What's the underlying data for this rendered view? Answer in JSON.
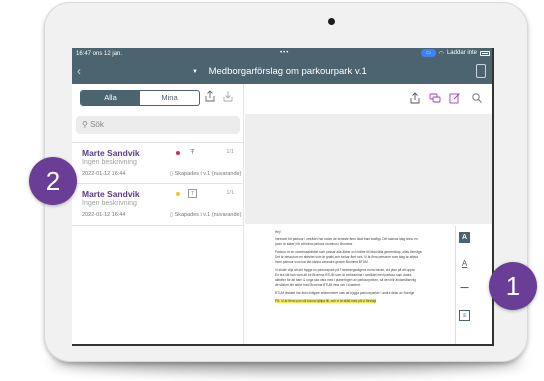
{
  "statusbar": {
    "time": "16:47  ons 12 jan.",
    "dots": "•••",
    "charging": "Laddar inte"
  },
  "navbar": {
    "title": "Medborgarförslag om parkourpark  v.1",
    "back_icon": "chevron-left-icon"
  },
  "tabs": {
    "all": "Alla",
    "mine": "Mina"
  },
  "search": {
    "placeholder": "Sök"
  },
  "items": [
    {
      "name": "Marte Sandvik",
      "desc": "Ingen beskrivning",
      "date": "2022-01-12 16:44",
      "status": "Skapades i v.1 (nuvarande)",
      "count": "1/1",
      "dot_color": "#e0245e"
    },
    {
      "name": "Marte Sandvik",
      "desc": "Ingen beskrivning",
      "date": "2022-01-12 16:44",
      "status": "Skapades i v.1 (nuvarande)",
      "count": "1/1",
      "dot_color": "#f5c518"
    }
  ],
  "document": {
    "greeting": "Hej!",
    "lines": [
      "Intresset för parkour i området har under de senaste åren ökat fram kraftigt. Det saknas idag ännu en",
      "(som är säker) för att träna parkour utomhus i Bromma.",
      "Parkour är en utomhusaktivitet som passar alla åldrar och bättre till lära hålla gemenskap, allas förmåga",
      "Det är dessutom en aktivitet som är gratis och funkar året runt. Vi är flera personer som idag är aktiva",
      "inom parkour som har lärt känna varandra genom Bromma BTUM.",
      "Vi skulle vilja att det byggs en parkourpark på Tranebergsvägens norra backe, vid ytan på att uppta",
      "En bra idé kan vara att be Bromma BTUM som är verksamma i området med parkour sam andra",
      "aktiviter för att barn & unga ska vara med i planeringen av parkourparken, så den blir ändamålsenlig",
      "de såklart blir aktivt med Bromma BTUM hela och i kvarteret.",
      "BTUM tävlatet har även tidigare erfarenheter utav att bygga parkourparker i andra delar av Sverige",
      "PS: Vi är flera som vill kunna hjälpa till, och vi är alltid med på vi förslag!"
    ]
  },
  "badges": {
    "one": "1",
    "two": "2"
  },
  "colors": {
    "accent": "#4c6470",
    "name": "#5b3b8c",
    "badge": "#6a3d97",
    "highlight": "#f6e84a"
  }
}
